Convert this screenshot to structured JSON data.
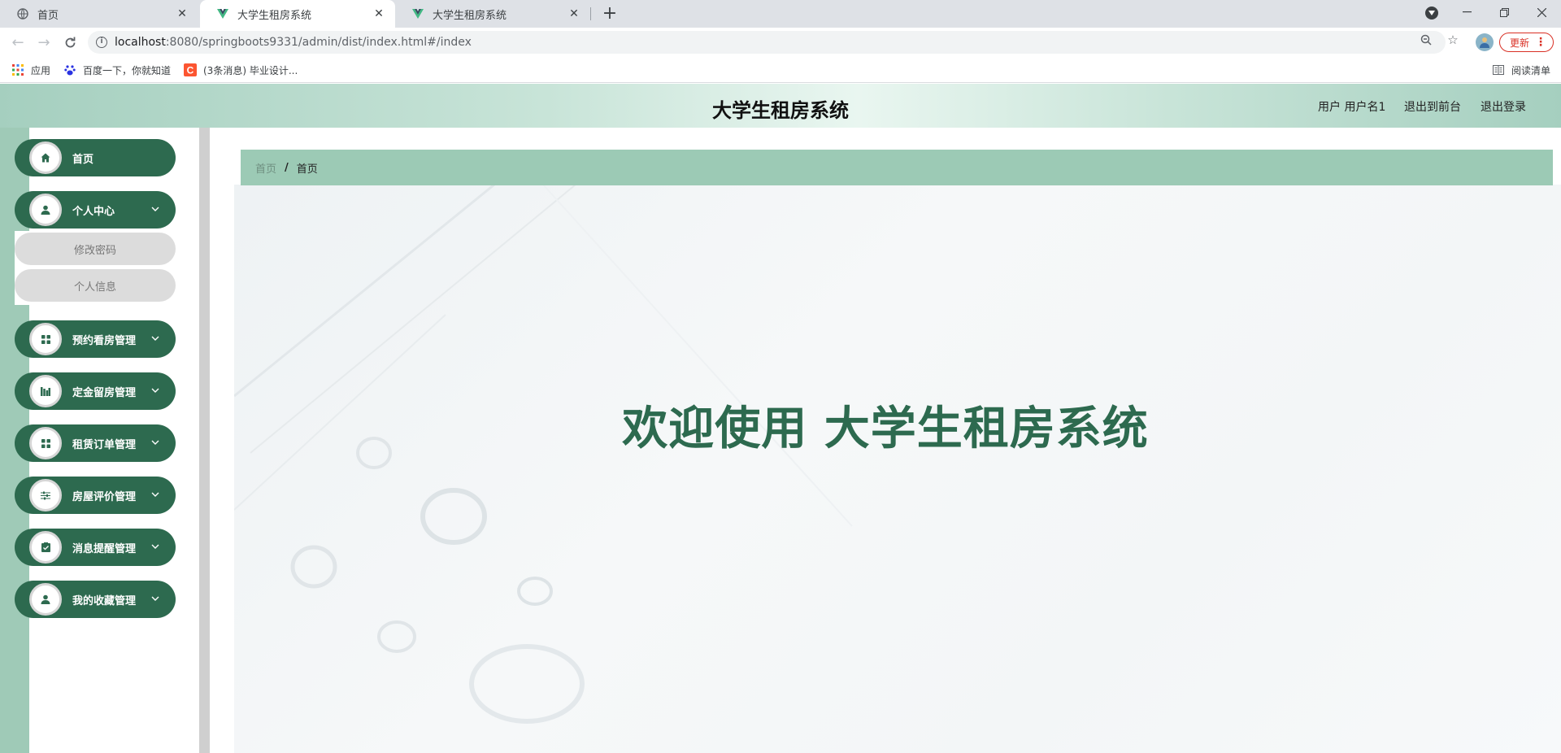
{
  "browser": {
    "tabs": [
      {
        "title": "首页",
        "icon": "globe-icon"
      },
      {
        "title": "大学生租房系统",
        "icon": "vue-logo-icon"
      },
      {
        "title": "大学生租房系统",
        "icon": "vue-logo-icon"
      }
    ],
    "url": {
      "host": "localhost",
      "path": ":8080/springboots9331/admin/dist/index.html#/index"
    },
    "update_label": "更新",
    "bookmarks": [
      {
        "label": "应用",
        "icon": "apps-grid-icon"
      },
      {
        "label": "百度一下，你就知道",
        "icon": "baidu-paw-icon"
      },
      {
        "label": "(3条消息) 毕业设计...",
        "icon": "csdn-icon"
      }
    ],
    "reading_list_label": "阅读清单"
  },
  "header": {
    "title": "大学生租房系统",
    "user_label": "用户 用户名1",
    "to_front_label": "退出到前台",
    "logout_label": "退出登录"
  },
  "sidebar": {
    "items": [
      {
        "label": "首页",
        "icon": "home-icon"
      },
      {
        "label": "个人中心",
        "icon": "user-icon",
        "children": [
          {
            "label": "修改密码"
          },
          {
            "label": "个人信息"
          }
        ]
      },
      {
        "label": "预约看房管理",
        "icon": "grid-icon"
      },
      {
        "label": "定金留房管理",
        "icon": "bar-chart-icon"
      },
      {
        "label": "租赁订单管理",
        "icon": "grid-icon"
      },
      {
        "label": "房屋评价管理",
        "icon": "sliders-icon"
      },
      {
        "label": "消息提醒管理",
        "icon": "clipboard-check-icon"
      },
      {
        "label": "我的收藏管理",
        "icon": "user-icon"
      }
    ]
  },
  "breadcrumb": {
    "root": "首页",
    "separator": "/",
    "current": "首页"
  },
  "main": {
    "welcome": "欢迎使用 大学生租房系统"
  },
  "colors": {
    "primary": "#2d6a4f",
    "breadcrumb_bg": "#9ccab5",
    "strip": "#9fcab7",
    "update_red": "#d93025"
  }
}
